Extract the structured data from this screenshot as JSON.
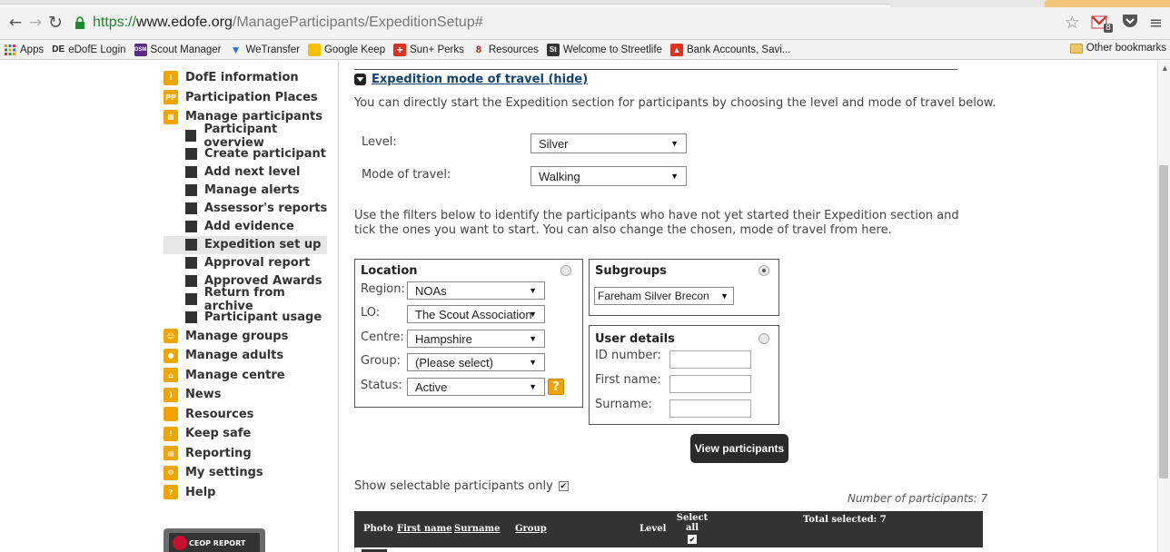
{
  "browser": {
    "url_https": "https://",
    "url_host": "www.edofe.org",
    "url_path": "/ManageParticipants/ExpeditionSetup#",
    "bookmarks": [
      {
        "label": "Apps",
        "icon": "apps-grid-icon",
        "color": "#e0a000"
      },
      {
        "label": "eDofE Login",
        "icon_text": "DE",
        "color": "#222222"
      },
      {
        "label": "Scout Manager",
        "icon_text": "OSM",
        "color": "#5a2d82"
      },
      {
        "label": "WeTransfer",
        "icon_text": "W",
        "color": "#3a6fd0"
      },
      {
        "label": "Google Keep",
        "icon_text": "",
        "color": "#f6c000"
      },
      {
        "label": "Sun+ Perks",
        "icon_text": "+",
        "color": "#e03020"
      },
      {
        "label": "Resources",
        "icon_text": "8",
        "color": "#b02020"
      },
      {
        "label": "Welcome to Streetlife",
        "icon_text": "St",
        "color": "#333333"
      },
      {
        "label": "Bank Accounts, Savi...",
        "icon_text": "",
        "color": "#e03020"
      }
    ],
    "other_bookmarks": "Other bookmarks",
    "gmail_badge": "8"
  },
  "sidebar": {
    "items": [
      {
        "label": "DofE information",
        "icon": "info-icon",
        "color": "#f0a400"
      },
      {
        "label": "Participation Places",
        "icon": "pp-icon",
        "color": "#f0a400",
        "icon_text": "PP"
      },
      {
        "label": "Manage participants",
        "icon": "people-grid-icon",
        "color": "#f0a400"
      }
    ],
    "subitems": [
      "Participant overview",
      "Create participant",
      "Add next level",
      "Manage alerts",
      "Assessor's reports",
      "Add evidence",
      "Expedition set up",
      "Approval report",
      "Approved Awards",
      "Return from archive",
      "Participant usage"
    ],
    "active_subitem": "Expedition set up",
    "items_after": [
      {
        "label": "Manage groups",
        "icon": "groups-icon",
        "color": "#f0a400"
      },
      {
        "label": "Manage adults",
        "icon": "adults-icon",
        "color": "#f0a400"
      },
      {
        "label": "Manage centre",
        "icon": "centre-icon",
        "color": "#f0a400"
      },
      {
        "label": "News",
        "icon": "rss-icon",
        "color": "#f0a400"
      },
      {
        "label": "Resources",
        "icon": "folder-icon",
        "color": "#f0a400"
      },
      {
        "label": "Keep safe",
        "icon": "keep-safe-icon",
        "color": "#f0a400"
      },
      {
        "label": "Reporting",
        "icon": "reporting-icon",
        "color": "#f0a400"
      },
      {
        "label": "My settings",
        "icon": "settings-icon",
        "color": "#f0a400"
      },
      {
        "label": "Help",
        "icon": "help-icon",
        "color": "#f0a400"
      }
    ],
    "ceop_label": "CEOP REPORT"
  },
  "main": {
    "section_title": "Expedition mode of travel (hide)",
    "intro": "You can directly start the Expedition section for participants by choosing the level and mode of travel below.",
    "level_label": "Level:",
    "level_value": "Silver",
    "mode_label": "Mode of travel:",
    "mode_value": "Walking",
    "filter_text": "Use the filters below to identify the participants who have not yet started their Expedition section and tick the ones you want to start. You can also change the chosen, mode of travel from here.",
    "location": {
      "title": "Location",
      "region_label": "Region:",
      "region_value": "NOAs",
      "lo_label": "LO:",
      "lo_value": "The Scout Association",
      "centre_label": "Centre:",
      "centre_value": "Hampshire",
      "group_label": "Group:",
      "group_value": "(Please select)",
      "status_label": "Status:",
      "status_value": "Active",
      "help_text": "?"
    },
    "subgroups": {
      "title": "Subgroups",
      "value": "Fareham Silver Brecon"
    },
    "user_details": {
      "title": "User details",
      "id_label": "ID number:",
      "first_label": "First name:",
      "surname_label": "Surname:"
    },
    "view_button": "View participants",
    "show_selectable": "Show selectable participants only",
    "count": "Number of participants: 7",
    "table": {
      "photo": "Photo",
      "first_name": "First name",
      "surname": "Surname",
      "group": "Group",
      "level": "Level",
      "select_all": "Select all",
      "total_selected": "Total selected: 7"
    }
  }
}
